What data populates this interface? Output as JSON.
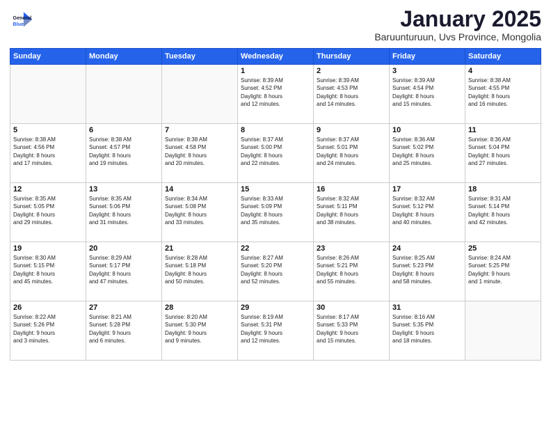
{
  "header": {
    "logo_general": "General",
    "logo_blue": "Blue",
    "month_title": "January 2025",
    "subtitle": "Baruunturuun, Uvs Province, Mongolia"
  },
  "weekdays": [
    "Sunday",
    "Monday",
    "Tuesday",
    "Wednesday",
    "Thursday",
    "Friday",
    "Saturday"
  ],
  "weeks": [
    [
      {
        "num": "",
        "info": ""
      },
      {
        "num": "",
        "info": ""
      },
      {
        "num": "",
        "info": ""
      },
      {
        "num": "1",
        "info": "Sunrise: 8:39 AM\nSunset: 4:52 PM\nDaylight: 8 hours\nand 12 minutes."
      },
      {
        "num": "2",
        "info": "Sunrise: 8:39 AM\nSunset: 4:53 PM\nDaylight: 8 hours\nand 14 minutes."
      },
      {
        "num": "3",
        "info": "Sunrise: 8:39 AM\nSunset: 4:54 PM\nDaylight: 8 hours\nand 15 minutes."
      },
      {
        "num": "4",
        "info": "Sunrise: 8:38 AM\nSunset: 4:55 PM\nDaylight: 8 hours\nand 16 minutes."
      }
    ],
    [
      {
        "num": "5",
        "info": "Sunrise: 8:38 AM\nSunset: 4:56 PM\nDaylight: 8 hours\nand 17 minutes."
      },
      {
        "num": "6",
        "info": "Sunrise: 8:38 AM\nSunset: 4:57 PM\nDaylight: 8 hours\nand 19 minutes."
      },
      {
        "num": "7",
        "info": "Sunrise: 8:38 AM\nSunset: 4:58 PM\nDaylight: 8 hours\nand 20 minutes."
      },
      {
        "num": "8",
        "info": "Sunrise: 8:37 AM\nSunset: 5:00 PM\nDaylight: 8 hours\nand 22 minutes."
      },
      {
        "num": "9",
        "info": "Sunrise: 8:37 AM\nSunset: 5:01 PM\nDaylight: 8 hours\nand 24 minutes."
      },
      {
        "num": "10",
        "info": "Sunrise: 8:36 AM\nSunset: 5:02 PM\nDaylight: 8 hours\nand 25 minutes."
      },
      {
        "num": "11",
        "info": "Sunrise: 8:36 AM\nSunset: 5:04 PM\nDaylight: 8 hours\nand 27 minutes."
      }
    ],
    [
      {
        "num": "12",
        "info": "Sunrise: 8:35 AM\nSunset: 5:05 PM\nDaylight: 8 hours\nand 29 minutes."
      },
      {
        "num": "13",
        "info": "Sunrise: 8:35 AM\nSunset: 5:06 PM\nDaylight: 8 hours\nand 31 minutes."
      },
      {
        "num": "14",
        "info": "Sunrise: 8:34 AM\nSunset: 5:08 PM\nDaylight: 8 hours\nand 33 minutes."
      },
      {
        "num": "15",
        "info": "Sunrise: 8:33 AM\nSunset: 5:09 PM\nDaylight: 8 hours\nand 35 minutes."
      },
      {
        "num": "16",
        "info": "Sunrise: 8:32 AM\nSunset: 5:11 PM\nDaylight: 8 hours\nand 38 minutes."
      },
      {
        "num": "17",
        "info": "Sunrise: 8:32 AM\nSunset: 5:12 PM\nDaylight: 8 hours\nand 40 minutes."
      },
      {
        "num": "18",
        "info": "Sunrise: 8:31 AM\nSunset: 5:14 PM\nDaylight: 8 hours\nand 42 minutes."
      }
    ],
    [
      {
        "num": "19",
        "info": "Sunrise: 8:30 AM\nSunset: 5:15 PM\nDaylight: 8 hours\nand 45 minutes."
      },
      {
        "num": "20",
        "info": "Sunrise: 8:29 AM\nSunset: 5:17 PM\nDaylight: 8 hours\nand 47 minutes."
      },
      {
        "num": "21",
        "info": "Sunrise: 8:28 AM\nSunset: 5:18 PM\nDaylight: 8 hours\nand 50 minutes."
      },
      {
        "num": "22",
        "info": "Sunrise: 8:27 AM\nSunset: 5:20 PM\nDaylight: 8 hours\nand 52 minutes."
      },
      {
        "num": "23",
        "info": "Sunrise: 8:26 AM\nSunset: 5:21 PM\nDaylight: 8 hours\nand 55 minutes."
      },
      {
        "num": "24",
        "info": "Sunrise: 8:25 AM\nSunset: 5:23 PM\nDaylight: 8 hours\nand 58 minutes."
      },
      {
        "num": "25",
        "info": "Sunrise: 8:24 AM\nSunset: 5:25 PM\nDaylight: 9 hours\nand 1 minute."
      }
    ],
    [
      {
        "num": "26",
        "info": "Sunrise: 8:22 AM\nSunset: 5:26 PM\nDaylight: 9 hours\nand 3 minutes."
      },
      {
        "num": "27",
        "info": "Sunrise: 8:21 AM\nSunset: 5:28 PM\nDaylight: 9 hours\nand 6 minutes."
      },
      {
        "num": "28",
        "info": "Sunrise: 8:20 AM\nSunset: 5:30 PM\nDaylight: 9 hours\nand 9 minutes."
      },
      {
        "num": "29",
        "info": "Sunrise: 8:19 AM\nSunset: 5:31 PM\nDaylight: 9 hours\nand 12 minutes."
      },
      {
        "num": "30",
        "info": "Sunrise: 8:17 AM\nSunset: 5:33 PM\nDaylight: 9 hours\nand 15 minutes."
      },
      {
        "num": "31",
        "info": "Sunrise: 8:16 AM\nSunset: 5:35 PM\nDaylight: 9 hours\nand 18 minutes."
      },
      {
        "num": "",
        "info": ""
      }
    ]
  ]
}
